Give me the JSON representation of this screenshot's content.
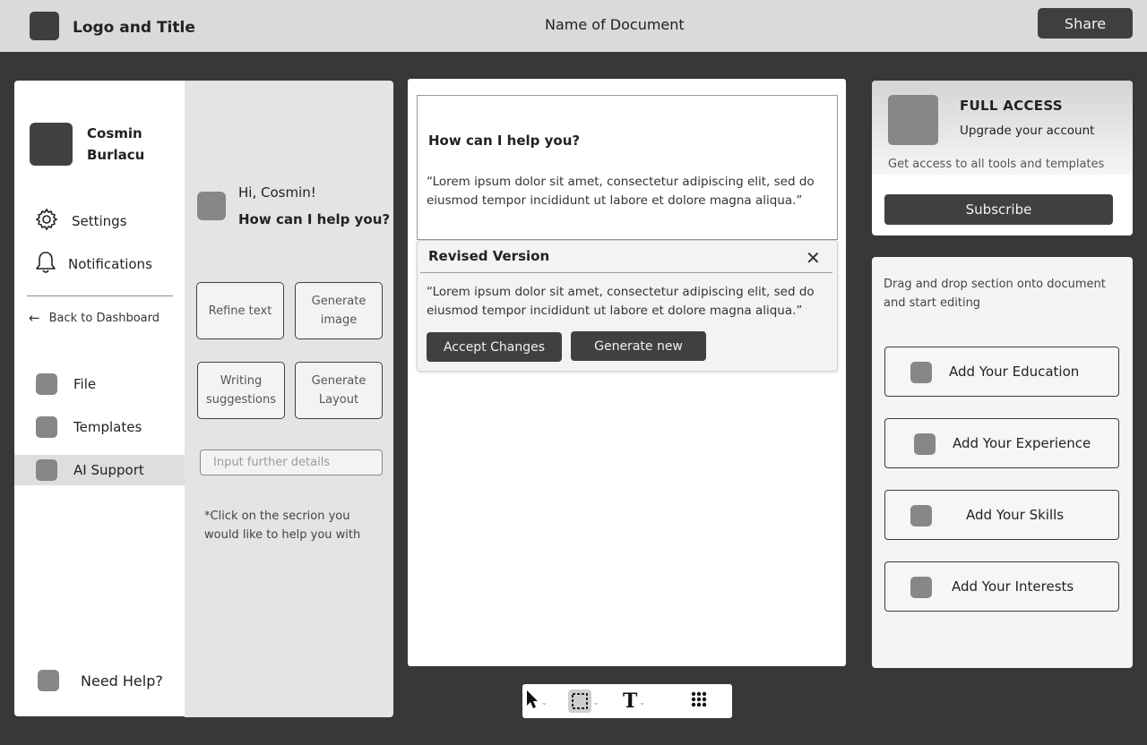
{
  "header": {
    "logo_title": "Logo and Title",
    "document_name": "Name of Document",
    "share_label": "Share"
  },
  "user": {
    "name": "Cosmin Burlacu"
  },
  "sidebar": {
    "settings_label": "Settings",
    "notifications_label": "Notifications",
    "back_label": "Back to Dashboard",
    "items": [
      {
        "label": "File"
      },
      {
        "label": "Templates"
      },
      {
        "label": "AI Support",
        "active": true
      }
    ],
    "help_label": "Need Help?"
  },
  "ai_panel": {
    "greeting": "Hi, Cosmin!",
    "question": "How can I help you?",
    "options": [
      {
        "label": "Refine text"
      },
      {
        "label": "Generate image"
      },
      {
        "label": "Writing suggestions"
      },
      {
        "label": "Generate Layout"
      }
    ],
    "input_placeholder": "Input further details",
    "note": "*Click on the  secrion you would like to help you with"
  },
  "document": {
    "heading": "How can I help you?",
    "paragraph": "“Lorem ipsum dolor sit amet, consectetur adipiscing elit, sed do eiusmod tempor incididunt ut labore et dolore magna aliqua.”"
  },
  "revised": {
    "title": "Revised Version",
    "close_glyph": "✕",
    "paragraph": "“Lorem ipsum dolor sit amet, consectetur adipiscing elit, sed do eiusmod tempor incididunt ut labore et dolore magna aliqua.”",
    "accept_label": "Accept Changes",
    "generate_label": "Generate new"
  },
  "toolbar": {
    "tools": [
      "pointer-tool",
      "select-tool",
      "text-tool",
      "grid-tool"
    ]
  },
  "upgrade": {
    "title": "FULL ACCESS",
    "subtitle": "Upgrade your account",
    "description": "Get access to all tools and templates",
    "subscribe_label": "Subscribe"
  },
  "sections": {
    "description": "Drag and drop section onto document and start editing",
    "items": [
      {
        "label": "Add Your Education"
      },
      {
        "label": "Add Your Experience"
      },
      {
        "label": "Add Your Skills"
      },
      {
        "label": "Add Your Interests"
      }
    ]
  }
}
